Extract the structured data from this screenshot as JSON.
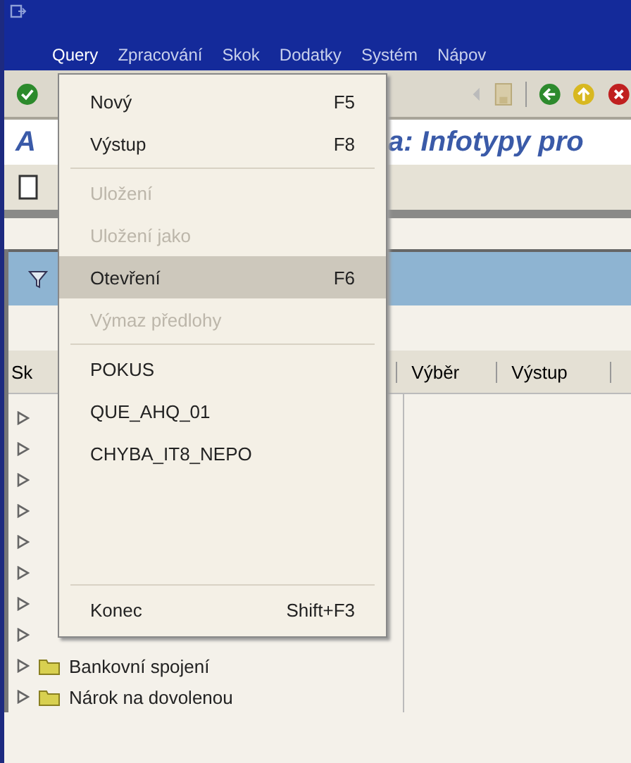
{
  "menubar": [
    {
      "label": "Query",
      "selected": true
    },
    {
      "label": "Zpracování",
      "selected": false
    },
    {
      "label": "Skok",
      "selected": false
    },
    {
      "label": "Dodatky",
      "selected": false
    },
    {
      "label": "Systém",
      "selected": false
    },
    {
      "label": "Nápov",
      "selected": false
    }
  ],
  "screen_title": {
    "start": "A",
    "end": "a: Infotypy pro"
  },
  "columns": [
    "Sk",
    "Výběr",
    "Výstup"
  ],
  "tree": [
    {
      "expanded": false
    },
    {
      "expanded": false
    },
    {
      "expanded": false
    },
    {
      "expanded": false
    },
    {
      "expanded": false
    },
    {
      "expanded": false
    },
    {
      "expanded": false
    },
    {
      "expanded": false
    },
    {
      "label": "Bankovní spojení",
      "expanded": false
    },
    {
      "label": "Nárok na dovolenou",
      "expanded": false
    }
  ],
  "menu": [
    {
      "kind": "item",
      "label": "Nový",
      "shortcut": "F5",
      "disabled": false,
      "selected": false
    },
    {
      "kind": "item",
      "label": "Výstup",
      "shortcut": "F8",
      "disabled": false,
      "selected": false
    },
    {
      "kind": "separator"
    },
    {
      "kind": "item",
      "label": "Uložení",
      "disabled": true,
      "selected": false
    },
    {
      "kind": "item",
      "label": "Uložení jako",
      "disabled": true,
      "selected": false
    },
    {
      "kind": "item",
      "label": "Otevření",
      "shortcut": "F6",
      "disabled": false,
      "selected": true
    },
    {
      "kind": "item",
      "label": "Výmaz předlohy",
      "disabled": true,
      "selected": false
    },
    {
      "kind": "separator"
    },
    {
      "kind": "item",
      "label": "POKUS",
      "disabled": false,
      "selected": false
    },
    {
      "kind": "item",
      "label": "QUE_AHQ_01",
      "disabled": false,
      "selected": false
    },
    {
      "kind": "item",
      "label": "CHYBA_IT8_NEPO",
      "disabled": false,
      "selected": false
    },
    {
      "kind": "spacer"
    },
    {
      "kind": "separator"
    },
    {
      "kind": "item",
      "label": "Konec",
      "shortcut": "Shift+F3",
      "disabled": false,
      "selected": false
    }
  ]
}
